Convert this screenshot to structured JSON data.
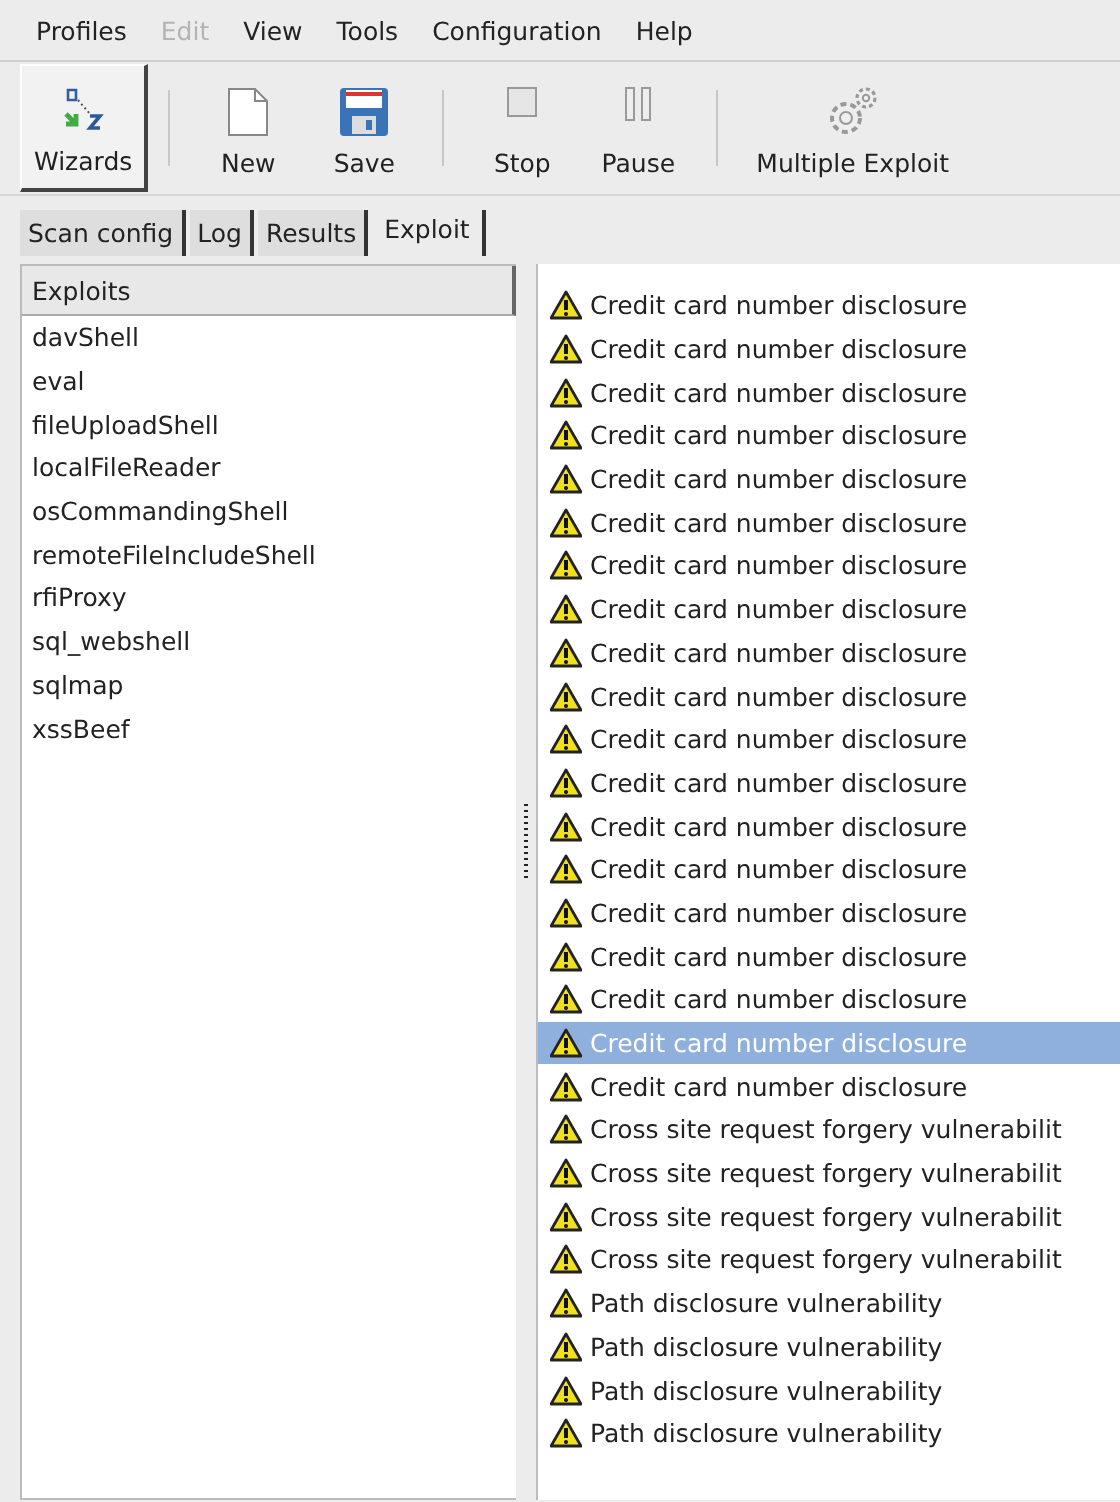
{
  "menu": [
    {
      "label": "Profiles",
      "disabled": false
    },
    {
      "label": "Edit",
      "disabled": true
    },
    {
      "label": "View",
      "disabled": false
    },
    {
      "label": "Tools",
      "disabled": false
    },
    {
      "label": "Configuration",
      "disabled": false
    },
    {
      "label": "Help",
      "disabled": false
    }
  ],
  "toolbar": [
    {
      "kind": "wizard",
      "label": "Wizards",
      "pressed": true
    },
    {
      "kind": "separator"
    },
    {
      "kind": "new",
      "label": "New",
      "pressed": false
    },
    {
      "kind": "save",
      "label": "Save",
      "pressed": false
    },
    {
      "kind": "separator"
    },
    {
      "kind": "stop",
      "label": "Stop",
      "pressed": false
    },
    {
      "kind": "pause",
      "label": "Pause",
      "pressed": false
    },
    {
      "kind": "separator"
    },
    {
      "kind": "gears",
      "label": "Multiple Exploit",
      "pressed": false
    }
  ],
  "tabs": [
    {
      "label": "Scan config",
      "selected": false
    },
    {
      "label": "Log",
      "selected": false
    },
    {
      "label": "Results",
      "selected": false
    },
    {
      "label": "Exploit",
      "selected": true
    }
  ],
  "exploits": {
    "header": "Exploits",
    "items": [
      "davShell",
      "eval",
      "fileUploadShell",
      "localFileReader",
      "osCommandingShell",
      "remoteFileIncludeShell",
      "rfiProxy",
      "sql_webshell",
      "sqlmap",
      "xssBeef"
    ]
  },
  "vulnerabilities": [
    {
      "label": "Credit card number disclosure",
      "selected": false
    },
    {
      "label": "Credit card number disclosure",
      "selected": false
    },
    {
      "label": "Credit card number disclosure",
      "selected": false
    },
    {
      "label": "Credit card number disclosure",
      "selected": false
    },
    {
      "label": "Credit card number disclosure",
      "selected": false
    },
    {
      "label": "Credit card number disclosure",
      "selected": false
    },
    {
      "label": "Credit card number disclosure",
      "selected": false
    },
    {
      "label": "Credit card number disclosure",
      "selected": false
    },
    {
      "label": "Credit card number disclosure",
      "selected": false
    },
    {
      "label": "Credit card number disclosure",
      "selected": false
    },
    {
      "label": "Credit card number disclosure",
      "selected": false
    },
    {
      "label": "Credit card number disclosure",
      "selected": false
    },
    {
      "label": "Credit card number disclosure",
      "selected": false
    },
    {
      "label": "Credit card number disclosure",
      "selected": false
    },
    {
      "label": "Credit card number disclosure",
      "selected": false
    },
    {
      "label": "Credit card number disclosure",
      "selected": false
    },
    {
      "label": "Credit card number disclosure",
      "selected": false
    },
    {
      "label": "Credit card number disclosure",
      "selected": true
    },
    {
      "label": "Credit card number disclosure",
      "selected": false
    },
    {
      "label": "Cross site request forgery vulnerabilit",
      "selected": false
    },
    {
      "label": "Cross site request forgery vulnerabilit",
      "selected": false
    },
    {
      "label": "Cross site request forgery vulnerabilit",
      "selected": false
    },
    {
      "label": "Cross site request forgery vulnerabilit",
      "selected": false
    },
    {
      "label": "Path disclosure vulnerability",
      "selected": false
    },
    {
      "label": "Path disclosure vulnerability",
      "selected": false
    },
    {
      "label": "Path disclosure vulnerability",
      "selected": false
    },
    {
      "label": "Path disclosure vulnerability",
      "selected": false
    }
  ]
}
